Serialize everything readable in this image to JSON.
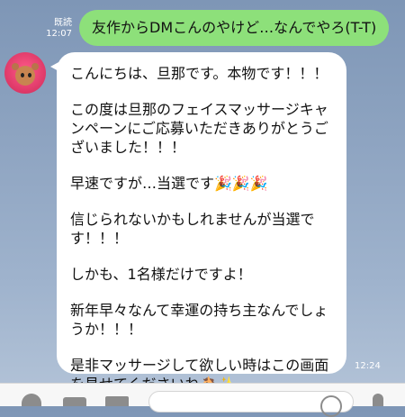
{
  "outgoing": {
    "read_label": "既読",
    "time": "12:07",
    "text": "友作からDMこんのやけど…なんでやろ(T-T)"
  },
  "incoming": {
    "time": "12:24",
    "paragraphs": [
      "こんにちは、旦那です。本物です！！！",
      "この度は旦那のフェイスマッサージキャ\nンペーンにご応募いただきありがとうご\nざいました！！！",
      "早速ですが…当選です🎉🎉🎉",
      "信じられないかもしれませんが当選で\nす！！！",
      "しかも、1名様だけですよ！",
      "新年早々なんて幸運の持ち主なんでしょ\nうか！！！",
      "是非マッサージして欲しい時はこの画面\nを見せてくださいね🐴✨"
    ]
  },
  "icons": {
    "avatar": "mascot-avatar",
    "toolbar": [
      "plus-icon",
      "camera-icon",
      "image-icon",
      "emoji-icon",
      "mic-icon"
    ]
  },
  "colors": {
    "outgoing_bubble": "#8de07a",
    "incoming_bubble": "#ffffff",
    "background": "#8ea4c1"
  }
}
